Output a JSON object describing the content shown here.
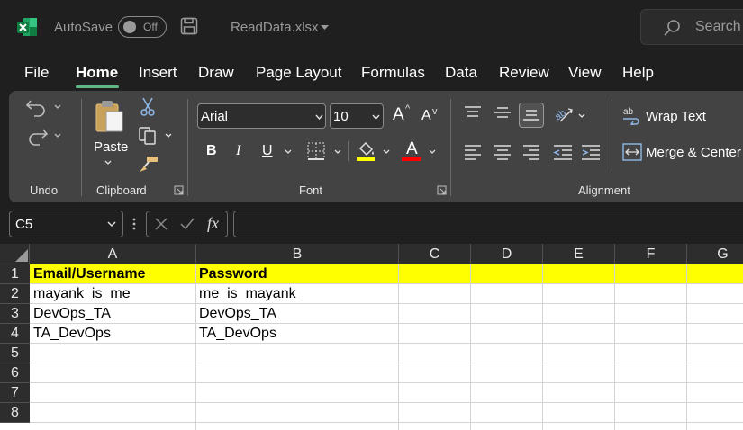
{
  "title_bar": {
    "autosave_label": "AutoSave",
    "autosave_state": "Off",
    "file_name": "ReadData.xlsx",
    "search_placeholder": "Search"
  },
  "menu": {
    "tabs": [
      "File",
      "Home",
      "Insert",
      "Draw",
      "Page Layout",
      "Formulas",
      "Data",
      "Review",
      "View",
      "Help"
    ],
    "active": "Home"
  },
  "ribbon": {
    "undo_group": "Undo",
    "clipboard_group": "Clipboard",
    "paste_label": "Paste",
    "font_group": "Font",
    "font_name": "Arial",
    "font_size": "10",
    "alignment_group": "Alignment",
    "wrap_text": "Wrap Text",
    "merge_center": "Merge & Center",
    "bold_glyph": "B",
    "italic_glyph": "I",
    "underline_glyph": "U",
    "grow_glyph": "A",
    "shrink_glyph": "A",
    "font_color_glyph": "A",
    "highlight_color": "#ffff00",
    "font_color": "#ff0000"
  },
  "formula_bar": {
    "name_box": "C5",
    "fx_label": "fx",
    "formula": ""
  },
  "sheet": {
    "columns": [
      "A",
      "B",
      "C",
      "D",
      "E",
      "F",
      "G"
    ],
    "rows": [
      "1",
      "2",
      "3",
      "4",
      "5",
      "6",
      "7",
      "8"
    ],
    "cells": {
      "A1": "Email/Username",
      "B1": "Password",
      "A2": "mayank_is_me",
      "B2": "me_is_mayank",
      "A3": "DevOps_TA",
      "B3": "DevOps_TA",
      "A4": "TA_DevOps",
      "B4": "TA_DevOps"
    },
    "header_fill": "#ffff00",
    "selected_cell": "C5"
  },
  "colors": {
    "accent": "#5fb785",
    "excel_green": "#107c41",
    "ribbon_bg": "#434343",
    "app_bg": "#1f1f1f"
  }
}
